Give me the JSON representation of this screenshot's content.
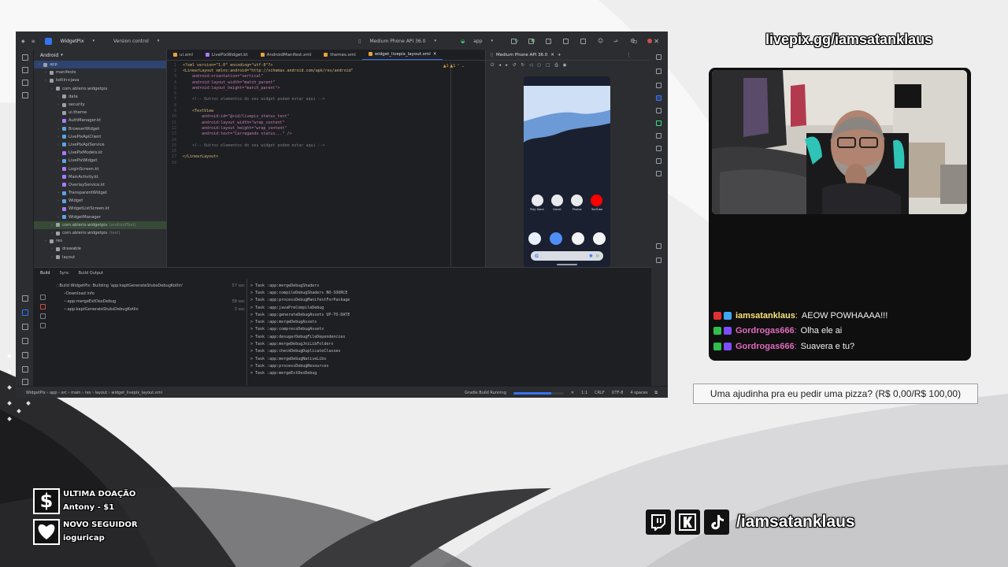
{
  "ide": {
    "project_name": "WidgetPix",
    "vcs": "Version control",
    "device": "Medium Phone API 36.0",
    "run_config": "app",
    "project_view": "Android",
    "project_tree": [
      {
        "label": "app",
        "depth": 0,
        "selected": true
      },
      {
        "label": "manifests",
        "depth": 1
      },
      {
        "label": "kotlin+java",
        "depth": 1
      },
      {
        "label": "com.ablerio.widgetpix",
        "depth": 2
      },
      {
        "label": "data",
        "depth": 3
      },
      {
        "label": "security",
        "depth": 3
      },
      {
        "label": "ui.theme",
        "depth": 3
      },
      {
        "label": "AuthManager.kt",
        "depth": 3
      },
      {
        "label": "BrowserWidget",
        "depth": 3
      },
      {
        "label": "LivePixApiClient",
        "depth": 3
      },
      {
        "label": "LivePixApiService",
        "depth": 3
      },
      {
        "label": "LivePixModels.kt",
        "depth": 3
      },
      {
        "label": "LivePixWidget",
        "depth": 3
      },
      {
        "label": "LoginScreen.kt",
        "depth": 3
      },
      {
        "label": "MainActivity.kt",
        "depth": 3
      },
      {
        "label": "OverlayService.kt",
        "depth": 3
      },
      {
        "label": "TransparentWidget",
        "depth": 3
      },
      {
        "label": "Widget",
        "depth": 3
      },
      {
        "label": "WidgetListScreen.kt",
        "depth": 3
      },
      {
        "label": "WidgetManager",
        "depth": 3
      },
      {
        "label": "com.ablerio.widgetpix",
        "ext": "(androidTest)",
        "depth": 2,
        "highlight": true
      },
      {
        "label": "com.ablerio.widgetpix",
        "ext": "(test)",
        "depth": 2
      },
      {
        "label": "res",
        "depth": 1
      },
      {
        "label": "drawable",
        "depth": 2
      },
      {
        "label": "layout",
        "depth": 2
      }
    ],
    "editor_tabs": [
      {
        "label": "ui.xml"
      },
      {
        "label": "LivePixWidget.kt"
      },
      {
        "label": "AndroidManifest.xml"
      },
      {
        "label": "themes.xml"
      },
      {
        "label": "widget_livepix_layout.xml",
        "active": true
      }
    ],
    "device_tab": "Medium Phone API 36.0",
    "code_lines": [
      {
        "n": "1",
        "t": "<?xml version=\"1.0\" encoding=\"utf-8\"?>"
      },
      {
        "n": "2",
        "t": "<LinearLayout xmlns:android=\"http://schemas.android.com/apk/res/android\""
      },
      {
        "n": "3",
        "t": "    android:orientation=\"vertical\""
      },
      {
        "n": "4",
        "t": "    android:layout_width=\"match_parent\""
      },
      {
        "n": "5",
        "t": "    android:layout_height=\"match_parent\">"
      },
      {
        "n": "6",
        "t": ""
      },
      {
        "n": "7",
        "t": "    <!-- Outros elementos do seu widget podem estar aqui -->"
      },
      {
        "n": "8",
        "t": ""
      },
      {
        "n": "9",
        "t": "    <TextView"
      },
      {
        "n": "10",
        "t": "        android:id=\"@+id/livepix_status_text\""
      },
      {
        "n": "11",
        "t": "        android:layout_width=\"wrap_content\""
      },
      {
        "n": "12",
        "t": "        android:layout_height=\"wrap_content\""
      },
      {
        "n": "13",
        "t": "        android:text=\"Carregando status...\" />"
      },
      {
        "n": "14",
        "t": ""
      },
      {
        "n": "15",
        "t": "    <!-- Outros elementos do seu widget podem estar aqui -->"
      },
      {
        "n": "16",
        "t": ""
      },
      {
        "n": "17",
        "t": "</LinearLayout>"
      },
      {
        "n": "18",
        "t": ""
      }
    ],
    "phone_apps": [
      {
        "label": "Play Store",
        "color": "#e8eaed"
      },
      {
        "label": "Gmail",
        "color": "#e8eaed"
      },
      {
        "label": "Photos",
        "color": "#e8eaed"
      },
      {
        "label": "YouTube",
        "color": "#ff0000"
      }
    ],
    "phone_dock": [
      {
        "color": "#e8f0fe"
      },
      {
        "color": "#4f8ef7"
      },
      {
        "color": "#f1f3f4"
      },
      {
        "color": "#f1f3f4"
      }
    ],
    "google_g": "G",
    "build_tabs": [
      "Build",
      "Sync",
      "Build Output"
    ],
    "build_tree": [
      {
        "label": "Build WidgetPix: Building 'app:kaptGenerateStubsDebugKotlin'",
        "time": "57 sec"
      },
      {
        "label": "Download info",
        "time": ""
      },
      {
        "label": ":app:mergeExtDexDebug",
        "time": "58 sec"
      },
      {
        "label": ":app:kaptGenerateStubsDebugKotlin",
        "time": "3 sec"
      }
    ],
    "console_lines": [
      "> Task :app:mergeDebugShaders",
      "> Task :app:compileDebugShaders NO-SOURCE",
      "> Task :app:processDebugManifestForPackage",
      "> Task :app:javaPreCompileDebug",
      "> Task :app:generateDebugAssets UP-TO-DATE",
      "> Task :app:mergeDebugAssets",
      "> Task :app:compressDebugAssets",
      "> Task :app:desugarDebugFileDependencies",
      "> Task :app:mergeDebugJniLibFolders",
      "> Task :app:checkDebugDuplicateClasses",
      "> Task :app:mergeDebugNativeLibs",
      "> Task :app:processDebugResources",
      "> Task :app:mergeExtDexDebug"
    ],
    "status": {
      "breadcrumb": "WidgetPix › app › src › main › res › layout › widget_livepix_layout.xml",
      "task": "Gradle Build Running",
      "progress": 0.75,
      "pos": "1:1",
      "eol": "CRLF",
      "enc": "UTF-8",
      "indent": "4 spaces"
    }
  },
  "overlay": {
    "livepix_url": "livepix.gg/iamsatanklaus",
    "chat": [
      {
        "user": "iamsatanklaus",
        "msg": "AEOW POWHAAAA!!!",
        "color": "#f9e57a",
        "badge1": "#e03131",
        "badge2": "#3fa9f5"
      },
      {
        "user": "Gordrogas666",
        "msg": "Olha ele ai",
        "color": "#e06bbd",
        "badge1": "#2fbf4a",
        "badge2": "#7c4dff"
      },
      {
        "user": "Gordrogas666",
        "msg": "Suavera e tu?",
        "color": "#e06bbd",
        "badge1": "#2fbf4a",
        "badge2": "#7c4dff"
      }
    ],
    "donation_goal": "Uma ajudinha pra eu pedir uma pizza? (R$ 0,00/R$ 100,00)",
    "social_handle": "/iamsatanklaus",
    "last_donation_title": "ULTIMA DOAÇÃO",
    "last_donation_value": "Antony - $1",
    "new_follower_title": "NOVO SEGUIDOR",
    "new_follower_value": "ioguricap",
    "dollar_glyph": "$"
  }
}
